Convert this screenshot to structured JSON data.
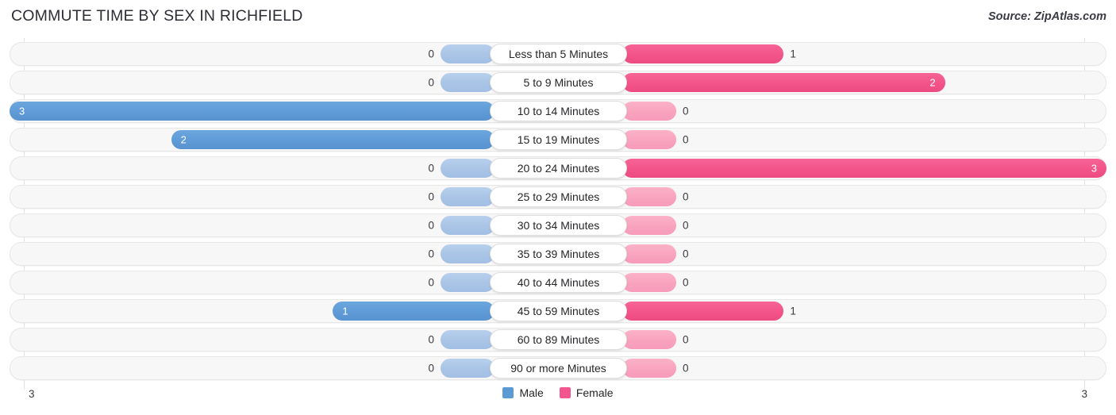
{
  "header": {
    "title": "COMMUTE TIME BY SEX IN RICHFIELD",
    "source": "Source: ZipAtlas.com"
  },
  "axis": {
    "left_label": "3",
    "right_label": "3"
  },
  "legend": {
    "items": [
      {
        "label": "Male",
        "color": "#5b9bd5"
      },
      {
        "label": "Female",
        "color": "#f2568e"
      }
    ]
  },
  "chart_data": {
    "type": "bar",
    "subtype": "diverging-horizontal",
    "title": "COMMUTE TIME BY SEX IN RICHFIELD",
    "xlabel": "",
    "ylabel": "",
    "xlim": [
      3,
      3
    ],
    "axis_max": 3,
    "grid": true,
    "legend_position": "bottom-center",
    "categories": [
      "Less than 5 Minutes",
      "5 to 9 Minutes",
      "10 to 14 Minutes",
      "15 to 19 Minutes",
      "20 to 24 Minutes",
      "25 to 29 Minutes",
      "30 to 34 Minutes",
      "35 to 39 Minutes",
      "40 to 44 Minutes",
      "45 to 59 Minutes",
      "60 to 89 Minutes",
      "90 or more Minutes"
    ],
    "series": [
      {
        "name": "Male",
        "color": "#5b9bd5",
        "side": "left",
        "values": [
          0,
          0,
          3,
          2,
          0,
          0,
          0,
          0,
          0,
          1,
          0,
          0
        ]
      },
      {
        "name": "Female",
        "color": "#f2568e",
        "side": "right",
        "values": [
          1,
          2,
          0,
          0,
          3,
          0,
          0,
          0,
          0,
          1,
          0,
          0
        ]
      }
    ]
  },
  "rows": [
    {
      "category": "Less than 5 Minutes",
      "male": "0",
      "female": "1"
    },
    {
      "category": "5 to 9 Minutes",
      "male": "0",
      "female": "2"
    },
    {
      "category": "10 to 14 Minutes",
      "male": "3",
      "female": "0"
    },
    {
      "category": "15 to 19 Minutes",
      "male": "2",
      "female": "0"
    },
    {
      "category": "20 to 24 Minutes",
      "male": "0",
      "female": "3"
    },
    {
      "category": "25 to 29 Minutes",
      "male": "0",
      "female": "0"
    },
    {
      "category": "30 to 34 Minutes",
      "male": "0",
      "female": "0"
    },
    {
      "category": "35 to 39 Minutes",
      "male": "0",
      "female": "0"
    },
    {
      "category": "40 to 44 Minutes",
      "male": "0",
      "female": "0"
    },
    {
      "category": "45 to 59 Minutes",
      "male": "1",
      "female": "1"
    },
    {
      "category": "60 to 89 Minutes",
      "male": "0",
      "female": "0"
    },
    {
      "category": "90 or more Minutes",
      "male": "0",
      "female": "0"
    }
  ]
}
